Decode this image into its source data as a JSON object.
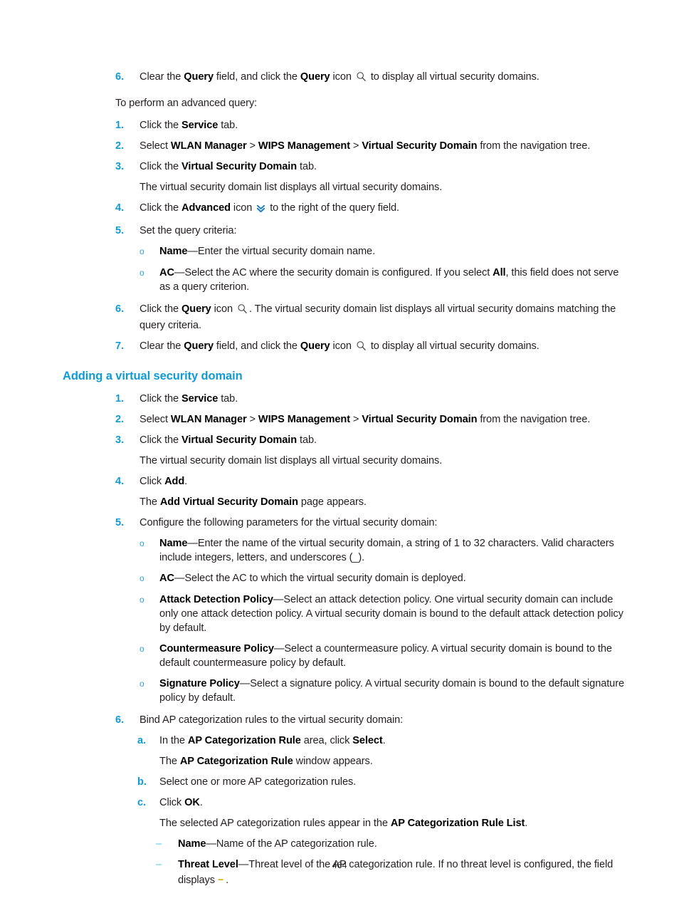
{
  "document": {
    "page_number": "464",
    "heading_color": "#0f9bd7",
    "body_color": "#231f20",
    "bullet_dash_color": "#4cc6e8",
    "placeholder_dash_color": "#d3b10a"
  },
  "icons": {
    "query": "search-icon",
    "advanced": "double-chevron-down-icon"
  },
  "blocks": {
    "item6_top": {
      "marker": "6.",
      "t1": "Clear the ",
      "b1": "Query",
      "t2": " field, and click the ",
      "b2": "Query",
      "t3": " icon ",
      "t4": " to display all virtual security domains."
    },
    "advanced_query_intro": "To perform an advanced query:",
    "adv1": {
      "marker": "1.",
      "t1": "Click the ",
      "b1": "Service",
      "t2": " tab."
    },
    "adv2": {
      "marker": "2.",
      "t1": "Select ",
      "b1": "WLAN Manager",
      "t2": " > ",
      "b2": "WIPS Management",
      "t3": " > ",
      "b3": "Virtual Security Domain",
      "t4": " from the navigation tree."
    },
    "adv3": {
      "marker": "3.",
      "t1": "Click the ",
      "b1": "Virtual Security Domain",
      "t2": " tab."
    },
    "adv3_cont": "The virtual security domain list displays all virtual security domains.",
    "adv4": {
      "marker": "4.",
      "t1": "Click the ",
      "b1": "Advanced",
      "t2": " icon ",
      "t3": " to the right of the query field."
    },
    "adv5": {
      "marker": "5.",
      "t1": "Set the query criteria:"
    },
    "adv5_name": {
      "marker": "o",
      "b1": "Name",
      "t1": "—Enter the virtual security domain name."
    },
    "adv5_ac": {
      "marker": "o",
      "b1": "AC",
      "t1": "—Select the AC where the security domain is configured. If you select ",
      "b2": "All",
      "t2": ", this field does not serve as a query criterion."
    },
    "adv6": {
      "marker": "6.",
      "t1": "Click the ",
      "b1": "Query",
      "t2": " icon ",
      "t3": ". The virtual security domain list displays all virtual security domains matching the query criteria."
    },
    "adv7": {
      "marker": "7.",
      "t1": "Clear the ",
      "b1": "Query",
      "t2": " field, and click the ",
      "b2": "Query",
      "t3": " icon ",
      "t4": " to display all virtual security domains."
    },
    "section_heading": "Adding a virtual security domain",
    "add1": {
      "marker": "1.",
      "t1": "Click the ",
      "b1": "Service",
      "t2": " tab."
    },
    "add2": {
      "marker": "2.",
      "t1": "Select ",
      "b1": "WLAN Manager",
      "t2": " > ",
      "b2": "WIPS Management",
      "t3": " > ",
      "b3": "Virtual Security Domain",
      "t4": " from the navigation tree."
    },
    "add3": {
      "marker": "3.",
      "t1": "Click the ",
      "b1": "Virtual Security Domain",
      "t2": " tab."
    },
    "add3_cont": "The virtual security domain list displays all virtual security domains.",
    "add4": {
      "marker": "4.",
      "t1": "Click ",
      "b1": "Add",
      "t2": "."
    },
    "add4_cont": {
      "t1": "The ",
      "b1": "Add Virtual Security Domain",
      "t2": " page appears."
    },
    "add5": {
      "marker": "5.",
      "t1": "Configure the following parameters for the virtual security domain:"
    },
    "add5_name": {
      "marker": "o",
      "b1": "Name",
      "t1": "—Enter the name of the virtual security domain, a string of 1 to 32 characters. Valid characters include integers, letters, and underscores (_)."
    },
    "add5_ac": {
      "marker": "o",
      "b1": "AC",
      "t1": "—Select the AC to which the virtual security domain is deployed."
    },
    "add5_attack": {
      "marker": "o",
      "b1": "Attack Detection Policy",
      "t1": "—Select an attack detection policy. One virtual security domain can include only one attack detection policy. A virtual security domain is bound to the default attack detection policy by default."
    },
    "add5_counter": {
      "marker": "o",
      "b1": "Countermeasure Policy",
      "t1": "—Select a countermeasure policy. A virtual security domain is bound to the default countermeasure policy by default."
    },
    "add5_sig": {
      "marker": "o",
      "b1": "Signature Policy",
      "t1": "—Select a signature policy. A virtual security domain is bound to the default signature policy by default."
    },
    "add6": {
      "marker": "6.",
      "t1": "Bind AP categorization rules to the virtual security domain:"
    },
    "add6a": {
      "marker": "a.",
      "t1": "In the ",
      "b1": "AP Categorization Rule",
      "t2": " area, click ",
      "b2": "Select",
      "t3": "."
    },
    "add6a_cont": {
      "t1": "The ",
      "b1": "AP Categorization Rule",
      "t2": " window appears."
    },
    "add6b": {
      "marker": "b.",
      "t1": "Select one or more AP categorization rules."
    },
    "add6c": {
      "marker": "c.",
      "t1": "Click ",
      "b1": "OK",
      "t2": "."
    },
    "add6c_cont": {
      "t1": "The selected AP categorization rules appear in the ",
      "b1": "AP Categorization Rule List",
      "t2": "."
    },
    "add6c_name": {
      "marker": "–",
      "b1": "Name",
      "t1": "—Name of the AP categorization rule."
    },
    "add6c_threat": {
      "marker": "–",
      "b1": "Threat Level",
      "t1": "—Threat level of the AP categorization rule. If no threat level is configured, the field displays ",
      "dash": "--",
      "t2": " ."
    }
  }
}
